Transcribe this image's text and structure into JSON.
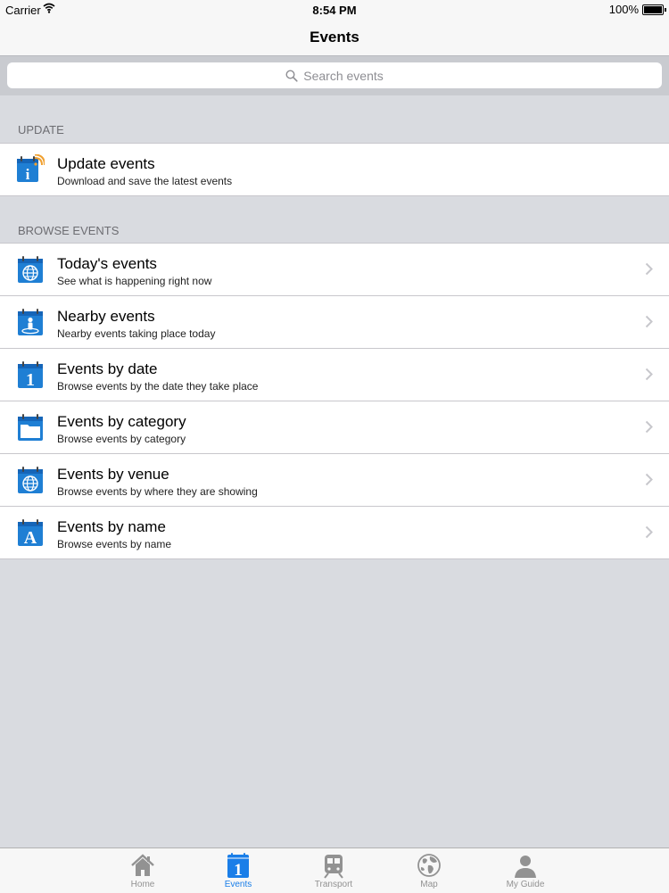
{
  "status_bar": {
    "carrier": "Carrier",
    "time": "8:54 PM",
    "battery": "100%"
  },
  "nav": {
    "title": "Events"
  },
  "search": {
    "placeholder": "Search events"
  },
  "sections": {
    "update": {
      "header": "UPDATE",
      "rows": [
        {
          "title": "Update events",
          "subtitle": "Download and save the latest events",
          "icon": "update-calendar-icon"
        }
      ]
    },
    "browse": {
      "header": "BROWSE EVENTS",
      "rows": [
        {
          "title": "Today's events",
          "subtitle": "See what is happening right now",
          "icon": "globe-calendar-icon"
        },
        {
          "title": "Nearby events",
          "subtitle": "Nearby events taking place today",
          "icon": "person-calendar-icon"
        },
        {
          "title": "Events by date",
          "subtitle": "Browse events by the date they take place",
          "icon": "date-calendar-icon"
        },
        {
          "title": "Events by category",
          "subtitle": "Browse events by category",
          "icon": "folder-calendar-icon"
        },
        {
          "title": "Events by venue",
          "subtitle": "Browse events by where they are showing",
          "icon": "globe-calendar-icon"
        },
        {
          "title": "Events by name",
          "subtitle": "Browse events by name",
          "icon": "letter-calendar-icon"
        }
      ]
    }
  },
  "tabs": [
    {
      "label": "Home",
      "icon": "home-icon",
      "active": false
    },
    {
      "label": "Events",
      "icon": "calendar-icon",
      "active": true
    },
    {
      "label": "Transport",
      "icon": "train-icon",
      "active": false
    },
    {
      "label": "Map",
      "icon": "globe-icon",
      "active": false
    },
    {
      "label": "My Guide",
      "icon": "person-icon",
      "active": false
    }
  ],
  "colors": {
    "accent": "#1a7ee8",
    "icon_blue": "#1f7fd4",
    "rss_orange": "#f0a030",
    "background": "#d9dbe0"
  }
}
